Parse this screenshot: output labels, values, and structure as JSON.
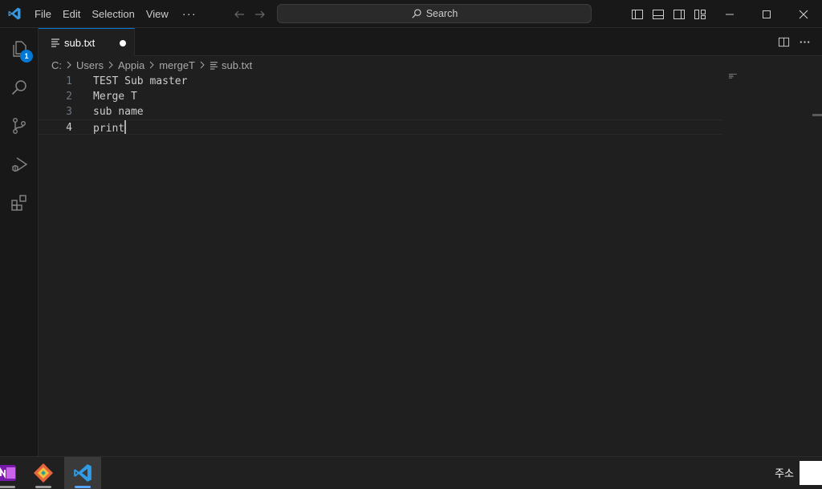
{
  "titlebar": {
    "menu": [
      "File",
      "Edit",
      "Selection",
      "View"
    ],
    "more": "···",
    "search_label": "Search"
  },
  "activitybar": {
    "explorer_badge": "1"
  },
  "tabs": [
    {
      "label": "sub.txt",
      "modified": true
    }
  ],
  "breadcrumb": [
    "C:",
    "Users",
    "Appia",
    "mergeT",
    "sub.txt"
  ],
  "editor": {
    "lines": [
      {
        "number": "1",
        "text": "TEST Sub master"
      },
      {
        "number": "2",
        "text": "Merge T"
      },
      {
        "number": "3",
        "text": "sub name"
      },
      {
        "number": "4",
        "text": "print"
      }
    ],
    "active_line": 4
  },
  "taskbar": {
    "apps": [
      "onenote-icon",
      "git-icon",
      "vscode-icon"
    ],
    "address_label": "주소"
  },
  "colors": {
    "accent": "#0078d4",
    "background": "#1f1f1f",
    "chrome": "#181818"
  }
}
